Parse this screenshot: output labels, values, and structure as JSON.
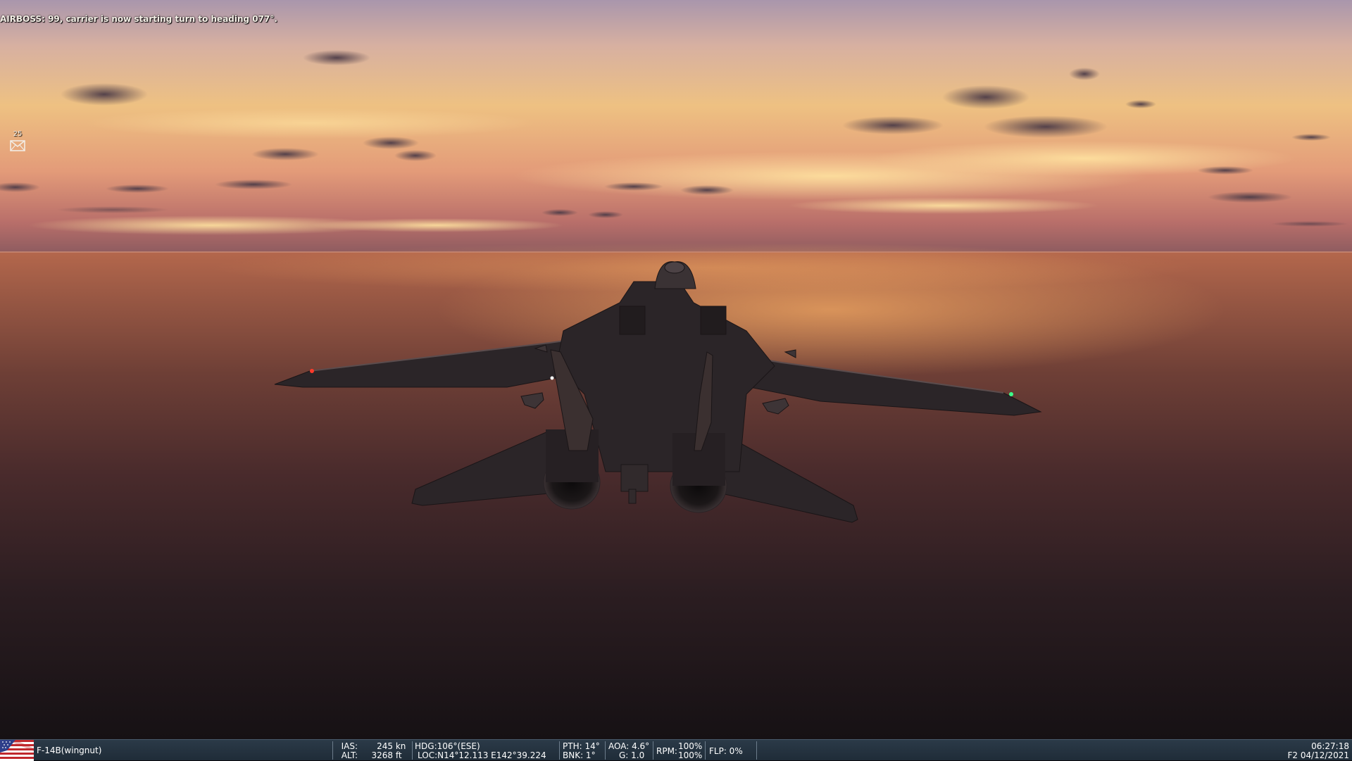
{
  "hud": {
    "message": "AIRBOSS: 99, carrier is now starting turn to heading 077°.",
    "message_count": "25",
    "message_icon": "envelope-icon"
  },
  "status_bar": {
    "flag_icon": "us-flag-icon",
    "aircraft": "F-14B(wingnut)",
    "ias_label": "IAS:",
    "ias_value": "245",
    "ias_unit": "kn",
    "alt_label": "ALT:",
    "alt_value": "3268",
    "alt_unit": "ft",
    "hdg": "HDG:106°(ESE)",
    "loc": "LOC:N14°12.113 E142°39.224",
    "pth": "PTH: 14°",
    "bnk": "BNK: 1°",
    "aoa": "AOA: 4.6°",
    "g": "G: 1.0",
    "rpm_label": "RPM:",
    "rpm_left": "100%",
    "rpm_right": "100%",
    "flp": "FLP: 0%",
    "time": "06:27:18",
    "date": "F2 04/12/2021"
  },
  "colors": {
    "sky_top": "#b9a3b6",
    "sky_glow": "#f1c77c",
    "horizon": "#c26b4d",
    "sea_dark": "#1c1418",
    "aircraft": "#2a2427",
    "status_bar": "#243342",
    "nav_light_left": "#ff3a2a",
    "nav_light_right": "#3cff8a"
  }
}
